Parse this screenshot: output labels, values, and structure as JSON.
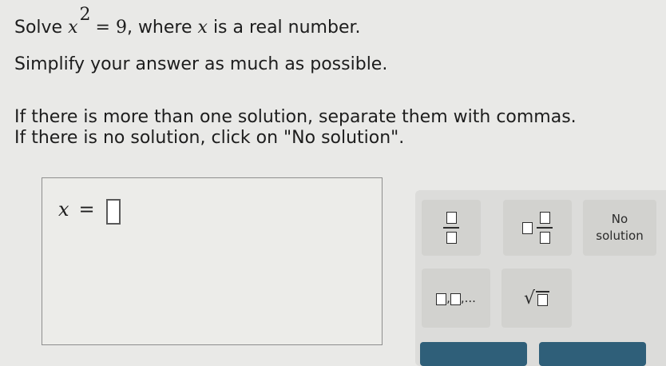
{
  "problem": {
    "prefix": "Solve",
    "variable": "x",
    "exponent": "2",
    "equals": "= 9",
    "suffix": ", where",
    "variable2": "x",
    "suffix2": "is a real number.",
    "line2": "Simplify your answer as much as possible.",
    "line3": "If there is more than one solution, separate them with commas.",
    "line4": "If there is no solution, click on \"No solution\"."
  },
  "answer": {
    "label": "x",
    "equals": "=",
    "value": ""
  },
  "keypad": {
    "no_solution_line1": "No",
    "no_solution_line2": "solution",
    "list_dots": ",..."
  },
  "colors": {
    "background": "#e9e9e7",
    "action_button": "#2f5f79"
  }
}
